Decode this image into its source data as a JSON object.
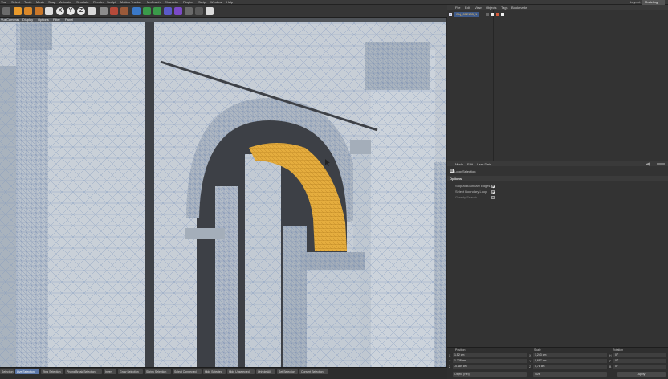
{
  "menubar": {
    "items": [
      "Vue",
      "Select",
      "Tools",
      "Mesh",
      "Snap",
      "Animate",
      "Simulate",
      "Render",
      "Sculpt",
      "Motion Tracker",
      "MoGraph",
      "Character",
      "Plugins",
      "Script",
      "Window",
      "Help"
    ],
    "layout_label": "Layout:",
    "layout_value": "Modeling"
  },
  "toolbar": {
    "axis_x": "X",
    "axis_y": "Y",
    "axis_z": "Z",
    "colors": {
      "orange": "#e89a2c",
      "blue": "#3a78c7",
      "green": "#3a9a4a",
      "red": "#c7403a"
    }
  },
  "viewport": {
    "menu": [
      "Vue",
      "Cameras",
      "Display",
      "Options",
      "Filter",
      "Panel"
    ],
    "colors": {
      "background": "#b8c0c9",
      "wire": "#6f8fbf",
      "selected_polygons": "#e5ad3e"
    }
  },
  "selection_bar": {
    "buttons": [
      "Selection",
      "Live Selection",
      "Ring Selection",
      "Phong Break Selection",
      "Invert",
      "Grow Selection",
      "Shrink Selection",
      "Select Connected",
      "Hide Selected",
      "Hide Unselected",
      "Unhide All",
      "Set Selection",
      "Convert Selection"
    ],
    "active_index": 1
  },
  "object_manager": {
    "menu": [
      "File",
      "Edit",
      "View",
      "Objects",
      "Tags",
      "Bookmarks"
    ],
    "object_name": "Obj_002133_1"
  },
  "attributes": {
    "menu": [
      "Mode",
      "Edit",
      "User Data"
    ],
    "tool_title": "Loop Selection",
    "options_header": "Options",
    "options": [
      {
        "label": "Stop at Boundary Edges",
        "checked": true
      },
      {
        "label": "Select Boundary Loop",
        "checked": true
      },
      {
        "label": "Greedy Search",
        "checked": false
      }
    ]
  },
  "coordinates": {
    "headers": {
      "position": "Position",
      "size": "Scale",
      "rotation": "Rotation"
    },
    "rows": [
      {
        "axis": "X",
        "position": "1.52 cm",
        "size": "1,243 cm",
        "rotation_axis": "H",
        "rotation": "0 °"
      },
      {
        "axis": "Y",
        "position": "1.728 cm",
        "size": "0,687 cm",
        "rotation_axis": "P",
        "rotation": "0 °"
      },
      {
        "axis": "Z",
        "position": "-0.189 cm",
        "size": "0,78 cm",
        "rotation_axis": "B",
        "rotation": "0 °"
      }
    ],
    "mode_select": "Object (Rel)",
    "size_select": "Size",
    "apply_label": "Apply"
  }
}
